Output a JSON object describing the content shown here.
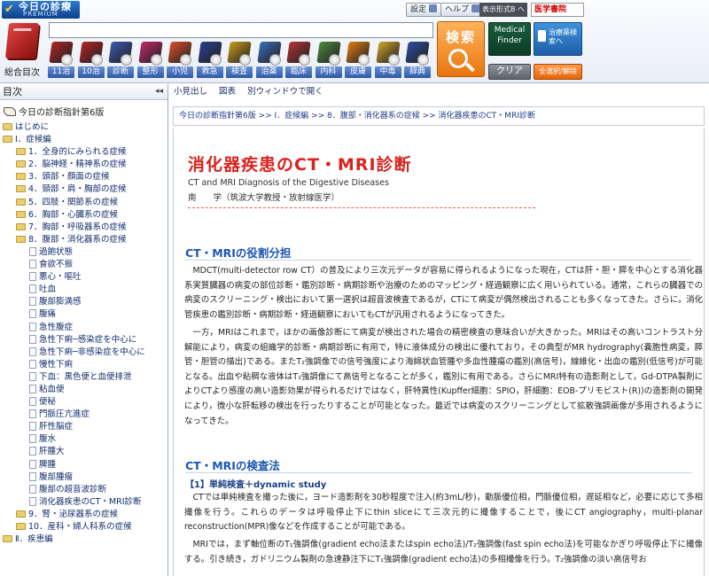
{
  "header": {
    "logo_name": "今日の診療",
    "logo_sub": "PREMIUM",
    "settings_label": "設定",
    "help_label": "ヘルプ",
    "view_mode_label": "表示形式B へ",
    "brand_label": "医学書院",
    "search_input_value": "",
    "search_button_label": "検索",
    "finder_label_1": "Medical",
    "finder_label_2": "Finder",
    "learn_label": "治療薬検索へ",
    "clear_label": "クリア",
    "select_all_label": "全選択/解除",
    "master_label": "総合目次",
    "books": [
      {
        "label": "11治",
        "color": "#b12424"
      },
      {
        "label": "10治",
        "color": "#b12424"
      },
      {
        "label": "診断",
        "color": "#3b58b0"
      },
      {
        "label": "整形",
        "color": "#bf2b6a"
      },
      {
        "label": "小児",
        "color": "#d94f2a"
      },
      {
        "label": "救急",
        "color": "#2a3f8f"
      },
      {
        "label": "検査",
        "color": "#c89a1c"
      },
      {
        "label": "治薬",
        "color": "#3a6bb9"
      },
      {
        "label": "臨床",
        "color": "#b33333"
      },
      {
        "label": "内科",
        "color": "#4b8a3c"
      },
      {
        "label": "皮膚",
        "color": "#e07b14"
      },
      {
        "label": "中毒",
        "color": "#cda32a"
      },
      {
        "label": "辞典",
        "color": "#2d4d9e"
      }
    ]
  },
  "sidebar": {
    "title": "目次",
    "root": "今日の診断指針第6版",
    "items": [
      {
        "label": "はじめに",
        "level": 0,
        "type": "folder"
      },
      {
        "label": "Ⅰ．症候編",
        "level": 0,
        "type": "folder"
      },
      {
        "label": "1．全身的にみられる症候",
        "level": 1,
        "type": "folder"
      },
      {
        "label": "2．脳神経・精神系の症候",
        "level": 1,
        "type": "folder"
      },
      {
        "label": "3．頭部・顔面の症候",
        "level": 1,
        "type": "folder"
      },
      {
        "label": "4．頸部・肩・胸部の症候",
        "level": 1,
        "type": "folder"
      },
      {
        "label": "5．四肢・関節系の症候",
        "level": 1,
        "type": "folder"
      },
      {
        "label": "6．胸部・心臓系の症候",
        "level": 1,
        "type": "folder"
      },
      {
        "label": "7．胸部・呼吸器系の症候",
        "level": 1,
        "type": "folder"
      },
      {
        "label": "8．腹部・消化器系の症候",
        "level": 1,
        "type": "folder"
      },
      {
        "label": "過飽状態",
        "level": 2,
        "type": "page"
      },
      {
        "label": "食欲不振",
        "level": 2,
        "type": "page"
      },
      {
        "label": "悪心・嘔吐",
        "level": 2,
        "type": "page"
      },
      {
        "label": "吐血",
        "level": 2,
        "type": "page"
      },
      {
        "label": "腹部膨満感",
        "level": 2,
        "type": "page"
      },
      {
        "label": "腹痛",
        "level": 2,
        "type": "page"
      },
      {
        "label": "急性腹症",
        "level": 2,
        "type": "page"
      },
      {
        "label": "急性下痢─感染症を中心に",
        "level": 2,
        "type": "page"
      },
      {
        "label": "急性下痢─非感染症を中心に",
        "level": 2,
        "type": "page"
      },
      {
        "label": "慢性下痢",
        "level": 2,
        "type": "page"
      },
      {
        "label": "下血：黒色便と血便排泄",
        "level": 2,
        "type": "page"
      },
      {
        "label": "粘血便",
        "level": 2,
        "type": "page"
      },
      {
        "label": "便秘",
        "level": 2,
        "type": "page"
      },
      {
        "label": "門脈圧亢進症",
        "level": 2,
        "type": "page"
      },
      {
        "label": "肝性脳症",
        "level": 2,
        "type": "page"
      },
      {
        "label": "腹水",
        "level": 2,
        "type": "page"
      },
      {
        "label": "肝腫大",
        "level": 2,
        "type": "page"
      },
      {
        "label": "脾腫",
        "level": 2,
        "type": "page"
      },
      {
        "label": "腹部腫瘤",
        "level": 2,
        "type": "page"
      },
      {
        "label": "腹部の超音波診断",
        "level": 2,
        "type": "page"
      },
      {
        "label": "消化器疾患のCT・MRI診断",
        "level": 2,
        "type": "page"
      },
      {
        "label": "9．腎・泌尿器系の症候",
        "level": 1,
        "type": "folder"
      },
      {
        "label": "10．産科・婦人科系の症候",
        "level": 1,
        "type": "folder"
      },
      {
        "label": "Ⅱ．疾患編",
        "level": 0,
        "type": "folder"
      }
    ]
  },
  "content": {
    "toolbar": {
      "headings": "小見出し",
      "figures": "図表",
      "new_window": "別ウィンドウで開く"
    },
    "breadcrumb": "今日の診断指針第6版 >> Ⅰ．症候編 >> 8．腹部・消化器系の症候 >> 消化器疾患のCT・MRI診断",
    "title": "消化器疾患のCT・MRI診断",
    "subtitle": "CT and MRI Diagnosis of the Digestive Diseases",
    "author": "南　　学（筑波大学教授・放射線医学）",
    "section1_heading": "CT・MRIの役割分担",
    "section1_p1": "　MDCT(multi-detector row CT）の普及により三次元データが容易に得られるようになった現在，CTは肝・胆・膵を中心とする消化器系実質臓器の病変の部位診断・鑑別診断・病期診断や治療のためのマッピング・経過観察に広く用いられている。通常，これらの臓器での病変のスクリーニング・検出において第一選択は超音波検査であるが，CTにて病変が偶然検出されることも多くなってきた。さらに，消化管疾患の鑑別診断・病期診断・経過観察においてもCTが汎用されるようになってきた。",
    "section1_p2": "　一方，MRIはこれまで，ほかの画像診断にて病変が検出された場合の精密検査の意味合いが大きかった。MRIはその高いコントラスト分解能により，病変の組織学的診断・病期診断に有用で，特に液体成分の検出に優れており，その典型がMR hydrography(嚢胞性病変，膵管・胆管の描出)である。またT₂強調像での信号強度により海綿状血管腫や多血性腫瘍の鑑別(高信号)，線維化・出血の鑑別(低信号)が可能となる。出血や粘稠な液体はT₁強調像にて高信号となることが多く，鑑別に有用である。さらにMRI特有の造影剤として，Gd-DTPA製剤によりCTより感度の高い造影効果が得られるだけではなく，肝特異性(Kupffer細胞：SPIO，肝細胞：EOB-プリモビスト(R))の造影剤の開発により，微小な肝転移の検出を行ったりすることが可能となった。最近では病変のスクリーニングとして拡散強調画像が多用されるようになってきた。",
    "section2_heading": "CT・MRIの検査法",
    "section2_sub": "【1】単純検査＋dynamic study",
    "section2_p1": "　CTでは単純検査を撮った後に，ヨード造影剤を30秒程度で注入(約3mL/秒)，動脈優位相，門脈優位相，遅延相など，必要に応じて多相撮像を行う。これらのデータは呼吸停止下にthin sliceにて三次元的に撮像することで，後にCT angiography，multi-planar reconstruction(MPR)像などを作成することが可能である。",
    "section2_p2": "　MRIでは，まず軸位断のT₁強調像(gradient echo法またはspin echo法)/T₂強調像(fast spin echo法)を可能なかぎり呼吸停止下に撮像する。引き続き，ガドリニウム製剤の急速静注下にT₁強調像(gradient echo法)の多相撮像を行う。T₂強調像の淡い高信号お"
  }
}
